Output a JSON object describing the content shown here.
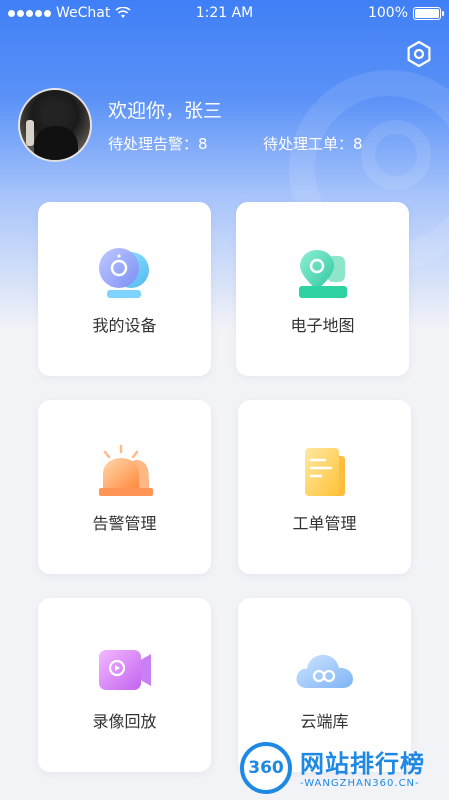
{
  "status_bar": {
    "carrier": "WeChat",
    "time": "1:21 AM",
    "battery": "100%"
  },
  "header": {
    "settings_icon": "hexagon-gear-icon",
    "greeting": "欢迎你，张三",
    "pending_alarms": "待处理告警：8",
    "pending_orders": "待处理工单：8"
  },
  "menu": [
    {
      "label": "我的设备",
      "icon": "camera-icon"
    },
    {
      "label": "电子地图",
      "icon": "map-pin-icon"
    },
    {
      "label": "告警管理",
      "icon": "alarm-light-icon"
    },
    {
      "label": "工单管理",
      "icon": "document-icon"
    },
    {
      "label": "录像回放",
      "icon": "video-play-icon"
    },
    {
      "label": "云端库",
      "icon": "cloud-icon"
    }
  ],
  "watermark": {
    "badge": "360",
    "title": "网站排行榜",
    "subtitle": "-WANGZHAN360.CN-"
  }
}
